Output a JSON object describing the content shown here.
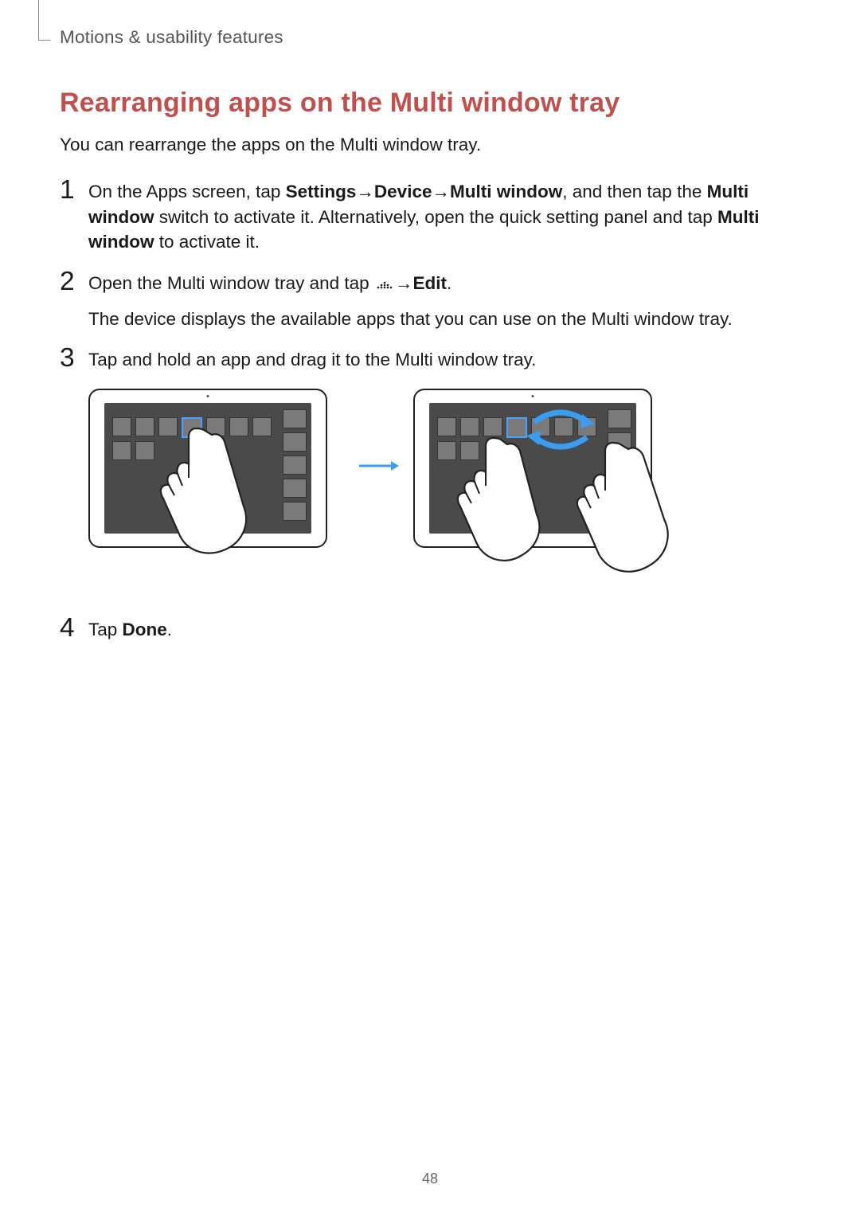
{
  "header": {
    "breadcrumb": "Motions & usability features"
  },
  "section": {
    "title": "Rearranging apps on the Multi window tray"
  },
  "intro": "You can rearrange the apps on the Multi window tray.",
  "steps": {
    "s1": {
      "num": "1",
      "t1": "On the Apps screen, tap ",
      "b1": "Settings",
      "arr1": " → ",
      "b2": "Device",
      "arr2": " → ",
      "b3": "Multi window",
      "t2": ", and then tap the ",
      "b4": "Multi window",
      "t3": " switch to activate it. Alternatively, open the quick setting panel and tap ",
      "b5": "Multi window",
      "t4": " to activate it."
    },
    "s2": {
      "num": "2",
      "t1": "Open the Multi window tray and tap ",
      "arr": " → ",
      "b1": "Edit",
      "t2": ".",
      "sub": "The device displays the available apps that you can use on the Multi window tray."
    },
    "s3": {
      "num": "3",
      "t1": "Tap and hold an app and drag it to the Multi window tray."
    },
    "s4": {
      "num": "4",
      "t1": "Tap ",
      "b1": "Done",
      "t2": "."
    }
  },
  "page_number": "48"
}
